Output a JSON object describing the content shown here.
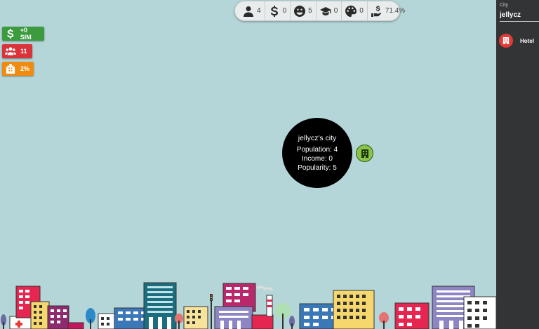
{
  "stats": [
    {
      "icon": "person-icon",
      "value": "4"
    },
    {
      "icon": "dollar-icon",
      "value": "0"
    },
    {
      "icon": "smile-icon",
      "value": "5"
    },
    {
      "icon": "graduation-cap-icon",
      "value": "0"
    },
    {
      "icon": "palette-icon",
      "value": "0"
    },
    {
      "icon": "hand-money-icon",
      "value": "71.4%"
    }
  ],
  "badges": {
    "money": {
      "icon": "dollar-icon",
      "label": "+0 SIM",
      "color": "#3c9a3f"
    },
    "population": {
      "icon": "users-icon",
      "label": "11",
      "color": "#d9343a"
    },
    "popularity": {
      "icon": "building-icon",
      "label": "2%",
      "color": "#f08b12"
    }
  },
  "city": {
    "name": "jellycz's city",
    "population": "Population: 4",
    "income": "Income: 0",
    "popularity": "Popularity: 5"
  },
  "panel": {
    "city_label": "City",
    "city_value": "jellycz",
    "items": [
      {
        "icon": "hotel-icon",
        "label": "Hotel",
        "color": "#e53935"
      }
    ]
  },
  "colors": {
    "sky": "#b5d6d8",
    "panel": "#333435",
    "marker": "#8bc34a"
  }
}
